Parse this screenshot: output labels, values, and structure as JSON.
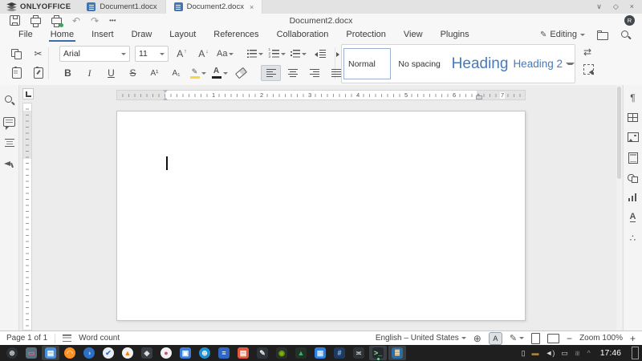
{
  "tab_bar": {
    "brand": "ONLYOFFICE",
    "tabs": [
      {
        "label": "Document1.docx",
        "active": false
      },
      {
        "label": "Document2.docx",
        "active": true
      }
    ]
  },
  "title_bar": {
    "title": "Document2.docx",
    "avatar_initial": "R"
  },
  "menu_bar": {
    "items": [
      "File",
      "Home",
      "Insert",
      "Draw",
      "Layout",
      "References",
      "Collaboration",
      "Protection",
      "View",
      "Plugins"
    ],
    "active_item": "Home",
    "editing_label": "Editing"
  },
  "toolbar": {
    "font_name": "Arial",
    "font_size": "11",
    "bold": "B",
    "italic": "I",
    "underline": "U",
    "strikeout": "S",
    "superscript": "A¹",
    "subscript": "A₁",
    "increase_font": "A",
    "decrease_font": "A",
    "change_case": "Aa",
    "font_color_letter": "A",
    "styles": [
      {
        "label": "Normal",
        "selected": true
      },
      {
        "label": "No spacing"
      },
      {
        "label": "Heading"
      },
      {
        "label": "Heading 2"
      }
    ]
  },
  "ruler": {
    "numbers": [
      "1",
      "2",
      "3",
      "4",
      "5",
      "6",
      "7"
    ]
  },
  "side_panels": {
    "left_icons": [
      "search",
      "comments",
      "navigation",
      "feedback"
    ],
    "right_icons": [
      "paragraph-settings",
      "table-settings",
      "image-settings",
      "header-footer-settings",
      "shape-settings",
      "chart-settings",
      "textart-settings",
      "smartart-settings"
    ]
  },
  "status_bar": {
    "page_indicator": "Page 1 of 1",
    "word_count_label": "Word count",
    "language": "English – United States",
    "zoom_label": "Zoom 100%"
  },
  "taskbar": {
    "clock": "17:46",
    "apps": [
      {
        "name": "app-menu",
        "glyph": "⊛",
        "bg": "#2e3236",
        "fg": "#c8ced4",
        "round": true
      },
      {
        "name": "screenshot-tool",
        "glyph": "▭",
        "bg": "#56707e",
        "fg": "#ff5c8a"
      },
      {
        "name": "file-manager",
        "glyph": "▤",
        "bg": "#4a90d9",
        "fg": "#ffffff",
        "active": true
      },
      {
        "name": "firefox",
        "glyph": "◠",
        "bg": "#ff9022",
        "fg": "#ffd9a0",
        "round": true
      },
      {
        "name": "browser",
        "glyph": "◑",
        "bg": "#2d6fc2",
        "fg": "#9ec4f2",
        "round": true
      },
      {
        "name": "tasks-app",
        "glyph": "✔",
        "bg": "#e9eef4",
        "fg": "#2f6fd0",
        "round": true
      },
      {
        "name": "vlc",
        "glyph": "▲",
        "bg": "#f3f3f3",
        "fg": "#ff7f00",
        "round": true
      },
      {
        "name": "image-editor",
        "glyph": "◆",
        "bg": "#3a3d42",
        "fg": "#d8dde2"
      },
      {
        "name": "media-player",
        "glyph": "●",
        "bg": "#f4f4f4",
        "fg": "#e0457b",
        "round": true
      },
      {
        "name": "document-viewer",
        "glyph": "▣",
        "bg": "#3b7dd8",
        "fg": "#ffffff"
      },
      {
        "name": "internet-browser",
        "glyph": "⊕",
        "bg": "#1f8fd0",
        "fg": "#ffffff",
        "round": true
      },
      {
        "name": "text-editor",
        "glyph": "≡",
        "bg": "#2f66c4",
        "fg": "#ffffff"
      },
      {
        "name": "presentation-app",
        "glyph": "▤",
        "bg": "#e4573d",
        "fg": "#ffffff"
      },
      {
        "name": "drawing-app",
        "glyph": "✎",
        "bg": "#30343a",
        "fg": "#e8e8e8"
      },
      {
        "name": "nvidia-settings",
        "glyph": "◉",
        "bg": "#2b2f2b",
        "fg": "#76b900"
      },
      {
        "name": "photo-viewer",
        "glyph": "▲",
        "bg": "#233229",
        "fg": "#3fae6a"
      },
      {
        "name": "toolbox",
        "glyph": "▦",
        "bg": "#2f7fe0",
        "fg": "#cfe3fa"
      },
      {
        "name": "calculator",
        "glyph": "#",
        "bg": "#1e3a5f",
        "fg": "#9fc3ef"
      },
      {
        "name": "settings-manager",
        "glyph": "≍",
        "bg": "#2e3338",
        "fg": "#cfd4da"
      },
      {
        "name": "terminal",
        "glyph": ">_",
        "bg": "#24292e",
        "fg": "#9ae69a",
        "active": true,
        "dot": true
      },
      {
        "name": "onlyoffice",
        "glyph": "≣",
        "bg": "#2d6da3",
        "fg": "#ffe8c2",
        "active": true
      }
    ]
  },
  "icons": {
    "minimize": "∨",
    "maximize": "◇",
    "close": "×",
    "tab_close": "×",
    "undo": "↶",
    "redo": "↷",
    "more": "•••",
    "cut": "✂",
    "pencil": "✎",
    "nonprinting": "¶",
    "line_numbers": "¶",
    "shading": "◇",
    "borders": "⊞",
    "replace": "⇄",
    "line_spacing": "↕",
    "arrow_up": "↑",
    "arrow_down": "↓",
    "paragraph_settings": "¶",
    "textart": "A",
    "smartart": "∴",
    "globe": "⊕",
    "spellcheck": "A",
    "track_changes": "✎",
    "zoom_out": "−",
    "zoom_in": "+",
    "caret_up": "^",
    "clipboard_tray": "▯",
    "briefcase_tray": "▬",
    "volume_tray": "◄)",
    "display_tray": "▭",
    "wifi_tray": "≋"
  }
}
